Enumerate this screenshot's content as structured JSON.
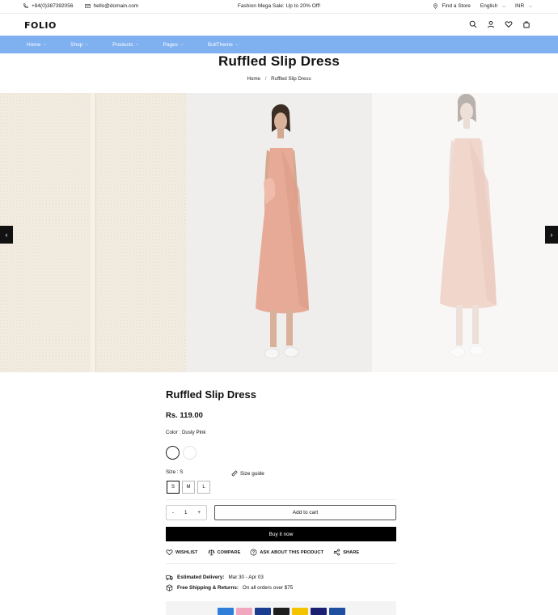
{
  "topbar": {
    "phone": "+84(0)387392056",
    "email": "hello@domain.com",
    "promo": "Fashion Mega Sale: Up to 20% Off!",
    "find_store": "Find a Store",
    "language": "English",
    "currency": "INR"
  },
  "header": {
    "logo": "FOLIO"
  },
  "nav": {
    "items": [
      {
        "label": "Home"
      },
      {
        "label": "Shop"
      },
      {
        "label": "Products"
      },
      {
        "label": "Pages"
      },
      {
        "label": "BullTheme"
      }
    ]
  },
  "page": {
    "title": "Ruffled Slip Dress",
    "breadcrumb": {
      "home": "Home",
      "separator": "/",
      "current": "Ruffled Slip Dress"
    }
  },
  "gallery": {
    "prev_icon": "chevron-left-icon",
    "next_icon": "chevron-right-icon",
    "colors": {
      "fabric": "#f2ece1",
      "dress": "#e9b2a2",
      "dress_faded": "#f1d7cf"
    }
  },
  "product": {
    "name": "Ruffled Slip Dress",
    "price": "Rs. 119.00",
    "color_label": "Color : Dusty Pink",
    "size_label": "Size : S",
    "size_guide": "Size guide",
    "sizes": [
      "S",
      "M",
      "L"
    ],
    "quantity": "1",
    "qty_minus": "-",
    "qty_plus": "+",
    "add_to_cart": "Add to cart",
    "buy_now": "Buy it now",
    "actions": {
      "wishlist": "WISHLIST",
      "compare": "COMPARE",
      "ask": "ASK ABOUT THIS PRODUCT",
      "share": "SHARE"
    },
    "delivery_label": "Estimated Delivery:",
    "delivery_value": "Mar 30 - Apr 03",
    "shipping_label": "Free Shipping & Returns:",
    "shipping_value": "On all orders over $75"
  },
  "payments": [
    {
      "name": "amex",
      "color": "#2f7fd8"
    },
    {
      "name": "klarna",
      "color": "#f2a7c0"
    },
    {
      "name": "visa-blue",
      "color": "#1a3d8f"
    },
    {
      "name": "mastercard",
      "color": "#1e1e1e"
    },
    {
      "name": "yellow-card",
      "color": "#f5c400"
    },
    {
      "name": "visa",
      "color": "#1a1f71"
    },
    {
      "name": "paypal",
      "color": "#1e4fa0"
    }
  ]
}
